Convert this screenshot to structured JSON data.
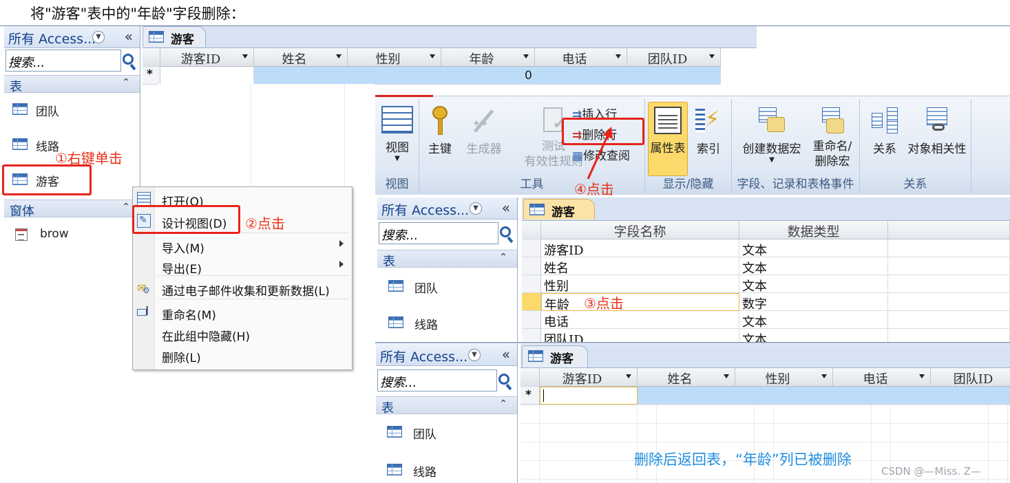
{
  "instruction": "将\"游客\"表中的\"年龄\"字段删除：",
  "nav1": {
    "header": "所有 Access...",
    "search_placeholder": "搜索...",
    "group_tables": "表",
    "tables": [
      "团队",
      "线路",
      "游客"
    ],
    "group_forms": "窗体",
    "forms": [
      "brow"
    ]
  },
  "nav2": {
    "header": "所有 Access...",
    "search_placeholder": "搜索...",
    "group_tables": "表",
    "tables": [
      "团队",
      "线路"
    ]
  },
  "nav3": {
    "header": "所有 Access...",
    "search_placeholder": "搜索...",
    "group_tables": "表",
    "tables": [
      "团队",
      "线路"
    ]
  },
  "datasheet1": {
    "tab": "游客",
    "columns": [
      "游客ID",
      "姓名",
      "性别",
      "年龄",
      "电话",
      "团队ID"
    ],
    "new_row_marker": "*",
    "new_row_age_default": "0"
  },
  "datasheet2": {
    "tab": "游客",
    "columns": [
      "游客ID",
      "姓名",
      "性别",
      "电话",
      "团队ID"
    ],
    "new_row_marker": "*"
  },
  "design": {
    "tab": "游客",
    "header_field": "字段名称",
    "header_type": "数据类型",
    "rows": [
      {
        "field": "游客ID",
        "type": "文本"
      },
      {
        "field": "姓名",
        "type": "文本"
      },
      {
        "field": "性别",
        "type": "文本"
      },
      {
        "field": "年龄",
        "type": "数字"
      },
      {
        "field": "电话",
        "type": "文本"
      },
      {
        "field": "团队ID",
        "type": "文本"
      }
    ]
  },
  "context_menu": {
    "items": [
      {
        "label": "打开(O)",
        "icon": "open-icon"
      },
      {
        "label": "设计视图(D)",
        "icon": "design-view-icon"
      },
      {
        "label": "导入(M)",
        "submenu": true
      },
      {
        "label": "导出(E)",
        "submenu": true
      },
      {
        "label": "通过电子邮件收集和更新数据(L)",
        "icon": "email-collect-icon"
      },
      {
        "label": "重命名(M)",
        "icon": "rename-icon"
      },
      {
        "label": "在此组中隐藏(H)"
      },
      {
        "label": "删除(L)"
      }
    ]
  },
  "ribbon": {
    "view_label": "视图",
    "view_group": "视图",
    "primary_key": "主键",
    "builder": "生成器",
    "test_rules_1": "测试",
    "test_rules_2": "有效性规则",
    "insert_row": "插入行",
    "delete_row": "删除行",
    "modify_lookup": "修改查阅",
    "tools_group": "工具",
    "property_sheet": "属性表",
    "indexes": "索引",
    "showhide_group": "显示/隐藏",
    "create_macro": "创建数据宏",
    "rename_macro_1": "重命名/",
    "rename_macro_2": "删除宏",
    "events_group": "字段、记录和表格事件",
    "relationships": "关系",
    "dependencies": "对象相关性",
    "rel_group": "关系"
  },
  "annotations": {
    "step1": "①右键单击",
    "step2": "②点击",
    "step3": "③点击",
    "step4": "④点击",
    "result": "删除后返回表，“年龄”列已被删除",
    "watermark": "CSDN @—Miss. Z—"
  },
  "colors": {
    "annotation_red": "#e8311a",
    "result_blue": "#1f8ee0",
    "selection_blue": "#bcdcf8",
    "ribbon_active": "#fbd96b"
  }
}
